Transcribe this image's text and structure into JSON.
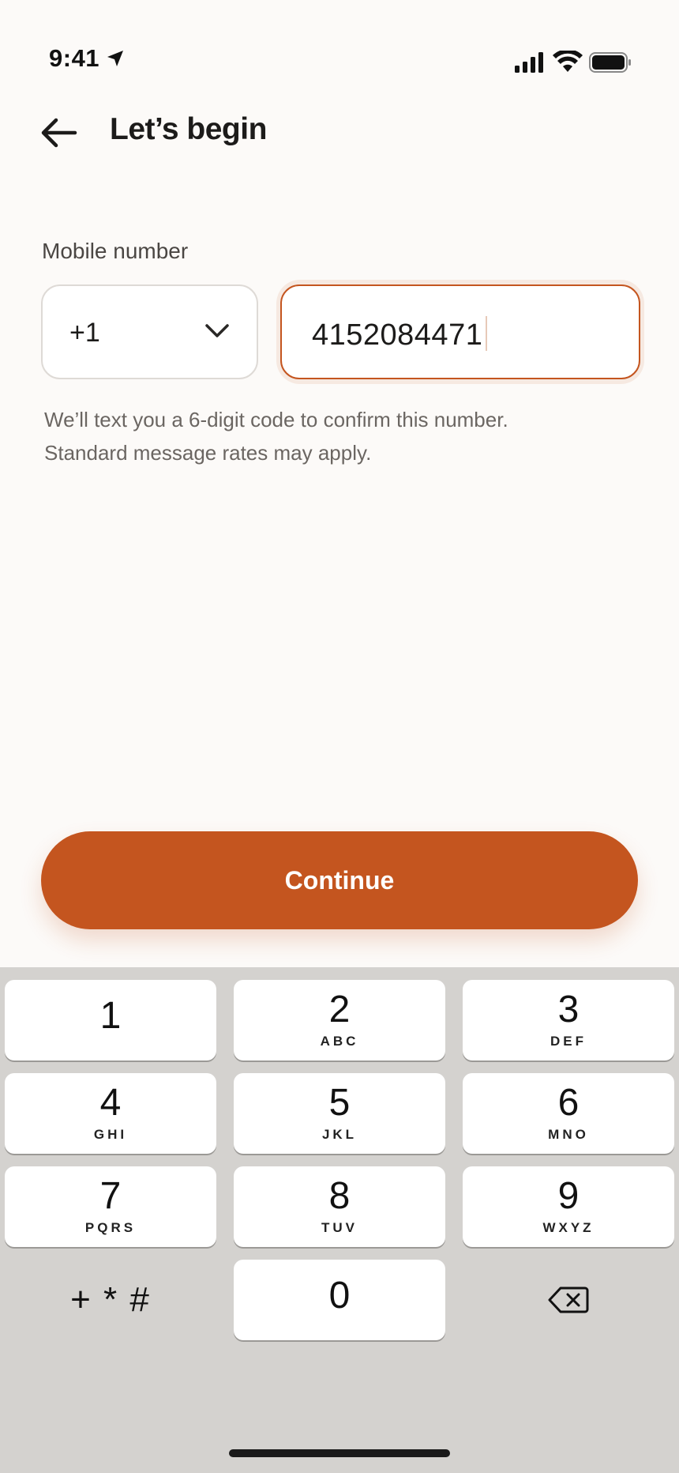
{
  "status_bar": {
    "time": "9:41",
    "icons": [
      "location-arrow-icon",
      "signal-icon",
      "wifi-icon",
      "battery-icon"
    ]
  },
  "header": {
    "title": "Let’s begin",
    "back_icon": "arrow-left-icon"
  },
  "form": {
    "label": "Mobile number",
    "country_code": "+1",
    "phone_value": "4152084471",
    "helper": "We’ll text you a 6-digit code to confirm this number. Standard message rates may apply."
  },
  "continue_label": "Continue",
  "colors": {
    "accent": "#C4551F",
    "background": "#FCFAF8",
    "keypad_bg": "#D4D2CF"
  },
  "keypad": {
    "keys": [
      {
        "digit": "1",
        "letters": ""
      },
      {
        "digit": "2",
        "letters": "ABC"
      },
      {
        "digit": "3",
        "letters": "DEF"
      },
      {
        "digit": "4",
        "letters": "GHI"
      },
      {
        "digit": "5",
        "letters": "JKL"
      },
      {
        "digit": "6",
        "letters": "MNO"
      },
      {
        "digit": "7",
        "letters": "PQRS"
      },
      {
        "digit": "8",
        "letters": "TUV"
      },
      {
        "digit": "9",
        "letters": "WXYZ"
      },
      {
        "digit": "0",
        "letters": ""
      }
    ],
    "symbols": "+ * #",
    "delete_icon": "backspace-icon"
  }
}
